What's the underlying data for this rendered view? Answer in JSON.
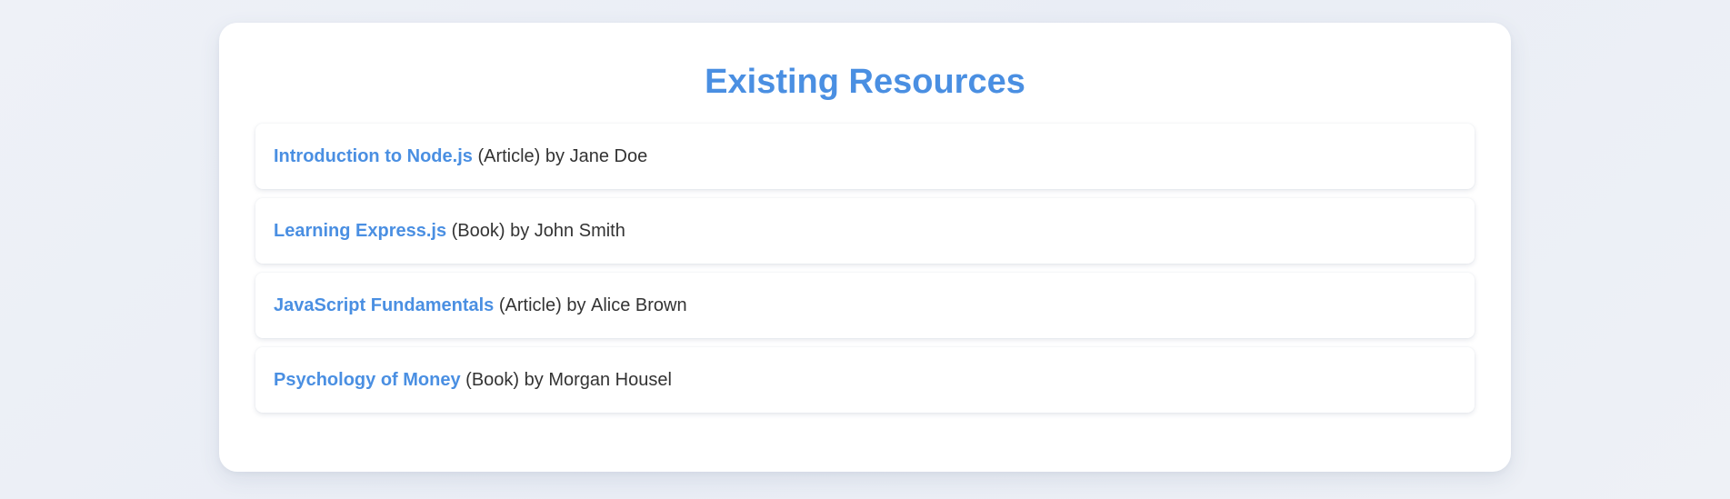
{
  "page": {
    "title": "Existing Resources"
  },
  "resources": [
    {
      "title": "Introduction to Node.js",
      "type": "(Article)",
      "by": "by",
      "author": "Jane Doe"
    },
    {
      "title": "Learning Express.js",
      "type": "(Book)",
      "by": "by",
      "author": "John Smith"
    },
    {
      "title": "JavaScript Fundamentals",
      "type": "(Article)",
      "by": "by",
      "author": "Alice Brown"
    },
    {
      "title": "Psychology of Money",
      "type": "(Book)",
      "by": "by",
      "author": "Morgan Housel"
    }
  ],
  "colors": {
    "accent": "#4a8fe2",
    "text": "#333333",
    "background": "#eef1f7",
    "card": "#ffffff"
  }
}
